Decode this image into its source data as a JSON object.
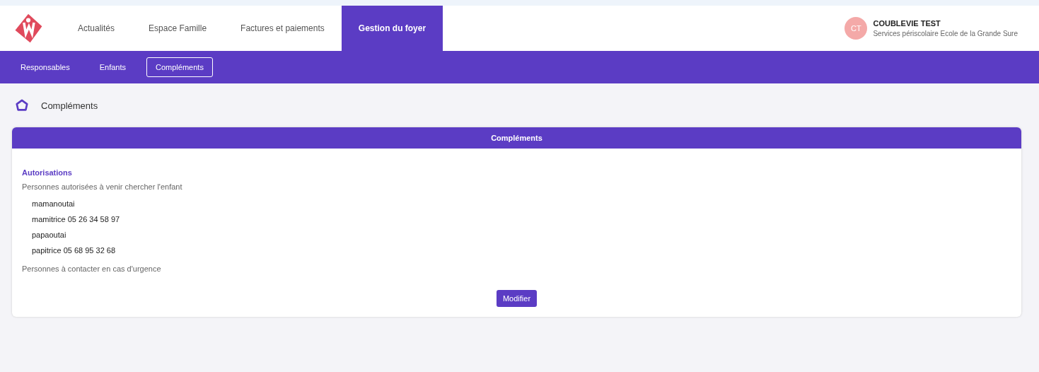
{
  "nav": {
    "tabs": [
      {
        "label": "Actualités",
        "selected": false
      },
      {
        "label": "Espace Famille",
        "selected": false
      },
      {
        "label": "Factures et paiements",
        "selected": false
      },
      {
        "label": "Gestion du foyer",
        "selected": true
      }
    ],
    "user": {
      "initials": "CT",
      "name": "COUBLEVIE TEST",
      "organization": "Services périscolaire Ecole de la Grande Sure"
    }
  },
  "subnav": {
    "tabs": [
      {
        "label": "Responsables",
        "selected": false
      },
      {
        "label": "Enfants",
        "selected": false
      },
      {
        "label": "Compléments",
        "selected": true
      }
    ]
  },
  "breadcrumb": {
    "label": "Compléments"
  },
  "card": {
    "title": "Compléments",
    "section_title": "Autorisations",
    "authorized_label": "Personnes autorisées à venir chercher l'enfant",
    "authorized_people": [
      "mamanoutai",
      "mamitrice 05 26 34 58 97",
      "papaoutai",
      "papitrice 05 68 95 32 68"
    ],
    "emergency_label": "Personnes à contacter en cas d'urgence",
    "button": "Modifier"
  }
}
